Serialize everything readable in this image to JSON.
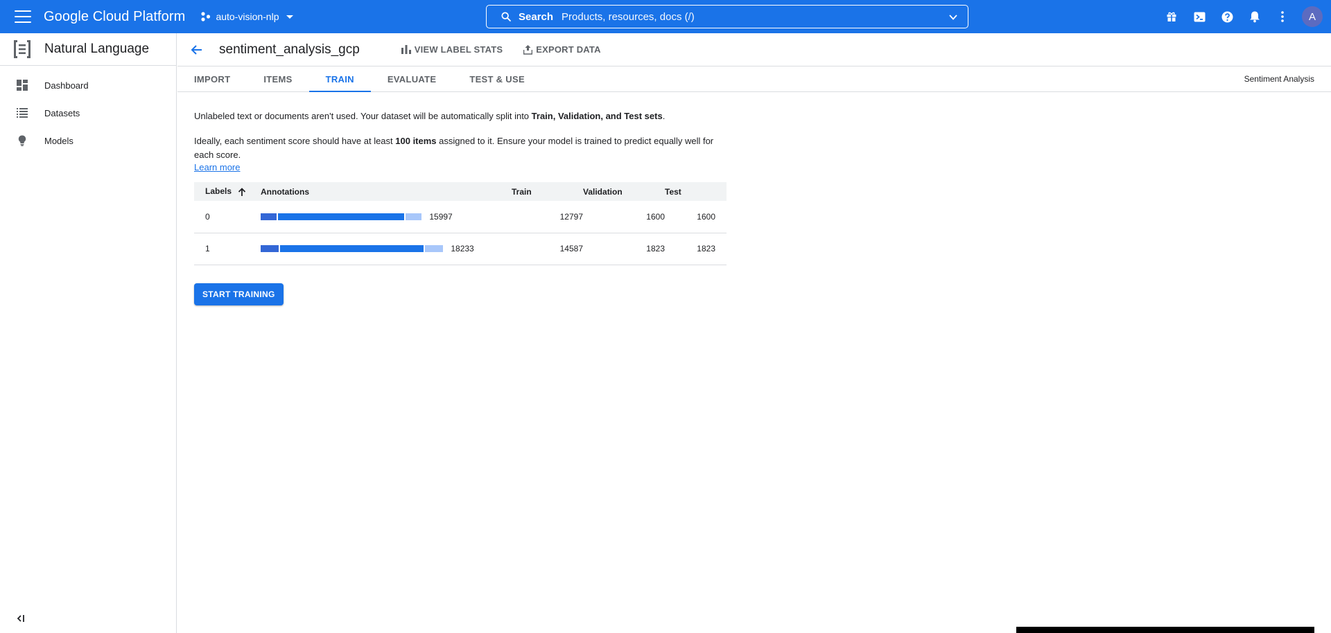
{
  "topbar": {
    "brand": "Google Cloud Platform",
    "project": "auto-vision-nlp",
    "search_label": "Search",
    "search_hint": "Products, resources, docs (/)",
    "avatar_letter": "A",
    "icons": [
      "gift-icon",
      "cloud-shell-icon",
      "help-icon",
      "notifications-icon",
      "more-vert-icon"
    ]
  },
  "sidebar": {
    "title": "Natural Language",
    "items": [
      {
        "label": "Dashboard",
        "icon": "dashboard-icon"
      },
      {
        "label": "Datasets",
        "icon": "list-icon"
      },
      {
        "label": "Models",
        "icon": "lightbulb-icon"
      }
    ]
  },
  "header": {
    "dataset_name": "sentiment_analysis_gcp",
    "view_label_stats": "VIEW LABEL STATS",
    "export_data": "EXPORT DATA"
  },
  "tabs": {
    "items": [
      "IMPORT",
      "ITEMS",
      "TRAIN",
      "EVALUATE",
      "TEST & USE"
    ],
    "active": "TRAIN",
    "right_label": "Sentiment Analysis"
  },
  "content": {
    "p1_a": "Unlabeled text or documents aren't used. Your dataset will be automatically split into ",
    "p1_b": "Train, Validation, and Test sets",
    "p1_c": ".",
    "p2_a": "Ideally, each sentiment score should have at least ",
    "p2_b": "100 items",
    "p2_c": " assigned to it. Ensure your model is trained to predict equally well for each score.",
    "learn_more": "Learn more"
  },
  "table": {
    "headers": {
      "labels": "Labels",
      "annotations": "Annotations",
      "train": "Train",
      "validation": "Validation",
      "test": "Test"
    },
    "rows": [
      {
        "label": "0",
        "annotations": "15997",
        "train": "12797",
        "validation": "1600",
        "test": "1600"
      },
      {
        "label": "1",
        "annotations": "18233",
        "train": "14587",
        "validation": "1823",
        "test": "1823"
      }
    ],
    "colors": {
      "train": "#1a73e8",
      "validation": "#3367d6",
      "test": "#a8c7fa"
    }
  },
  "actions": {
    "start_training": "START TRAINING"
  }
}
